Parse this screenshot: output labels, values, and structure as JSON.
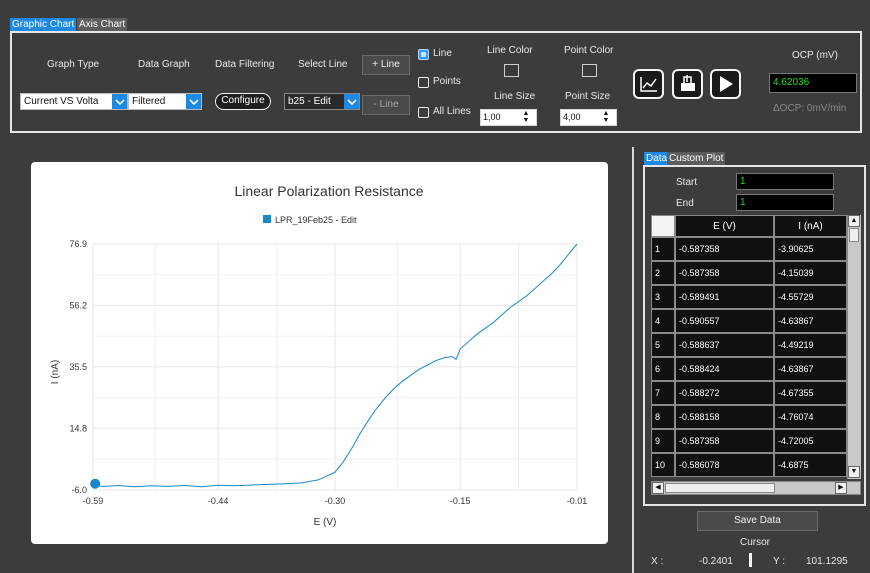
{
  "tabs": [
    {
      "label": "Graphic Chart",
      "active": true
    },
    {
      "label": "Axis Chart",
      "active": false
    }
  ],
  "toolbar": {
    "graph_type": {
      "label": "Graph Type",
      "value": "Current VS Volta"
    },
    "data_graph": {
      "label": "Data Graph",
      "value": "Filtered"
    },
    "data_filtering": {
      "label": "Data Filtering",
      "button": "Configure"
    },
    "select_line": {
      "label": "Select Line",
      "value": "b25 - Edit"
    },
    "add_line": "+ Line",
    "remove_line": "- Line",
    "mode": {
      "line": "Line",
      "points": "Points",
      "all_lines": "All Lines",
      "selected": "Line"
    },
    "line_color": {
      "label": "Line Color",
      "value": "#3a3a3a"
    },
    "point_color": {
      "label": "Point Color",
      "value": "#3a3a3a"
    },
    "line_size": {
      "label": "Line Size",
      "value": "1,00"
    },
    "point_size": {
      "label": "Point Size",
      "value": "4,00"
    },
    "icons": [
      "chart-icon",
      "export-icon",
      "play-icon"
    ],
    "ocp": {
      "label": "OCP (mV)",
      "value": "4.62036",
      "delta": "ΔOCP: 0mV/min"
    }
  },
  "chart_data": {
    "type": "line",
    "title": "Linear Polarization Resistance",
    "series": [
      {
        "name": "LPR_19Feb25 - Edit",
        "color": "#1a88c9"
      }
    ],
    "xlabel": "E (V)",
    "ylabel": "I (nA)",
    "xlim": [
      -0.59,
      -0.01
    ],
    "ylim": [
      -6.0,
      76.9
    ],
    "x_ticks": [
      "-0.59",
      "-0.44",
      "-0.30",
      "-0.15",
      "-0.01"
    ],
    "y_ticks": [
      "76.9",
      "56.2",
      "35.5",
      "14.8",
      "-6.0"
    ],
    "points": [
      [
        -0.5874,
        -3.9
      ],
      [
        -0.586,
        -4.7
      ],
      [
        -0.575,
        -4.8
      ],
      [
        -0.56,
        -4.5
      ],
      [
        -0.54,
        -4.9
      ],
      [
        -0.52,
        -4.6
      ],
      [
        -0.5,
        -4.8
      ],
      [
        -0.48,
        -4.5
      ],
      [
        -0.46,
        -4.9
      ],
      [
        -0.44,
        -4.4
      ],
      [
        -0.42,
        -4.6
      ],
      [
        -0.4,
        -4.3
      ],
      [
        -0.38,
        -4.1
      ],
      [
        -0.36,
        -3.9
      ],
      [
        -0.34,
        -3.6
      ],
      [
        -0.32,
        -2.6
      ],
      [
        -0.3,
        0.0
      ],
      [
        -0.29,
        3.5
      ],
      [
        -0.28,
        8.0
      ],
      [
        -0.27,
        13.0
      ],
      [
        -0.26,
        17.5
      ],
      [
        -0.25,
        21.5
      ],
      [
        -0.24,
        25.0
      ],
      [
        -0.23,
        28.0
      ],
      [
        -0.22,
        30.5
      ],
      [
        -0.21,
        32.5
      ],
      [
        -0.2,
        34.5
      ],
      [
        -0.19,
        36.0
      ],
      [
        -0.18,
        37.5
      ],
      [
        -0.17,
        38.5
      ],
      [
        -0.16,
        39.0
      ],
      [
        -0.155,
        38.0
      ],
      [
        -0.15,
        41.5
      ],
      [
        -0.14,
        44.0
      ],
      [
        -0.13,
        46.5
      ],
      [
        -0.12,
        48.5
      ],
      [
        -0.11,
        50.5
      ],
      [
        -0.1,
        53.0
      ],
      [
        -0.09,
        55.5
      ],
      [
        -0.08,
        57.5
      ],
      [
        -0.07,
        59.5
      ],
      [
        -0.06,
        62.0
      ],
      [
        -0.05,
        64.5
      ],
      [
        -0.04,
        67.0
      ],
      [
        -0.03,
        70.0
      ],
      [
        -0.02,
        73.5
      ],
      [
        -0.01,
        76.9
      ]
    ]
  },
  "data_panel": {
    "tabs": [
      {
        "label": "Data",
        "active": true
      },
      {
        "label": "Custom Plot",
        "active": false
      }
    ],
    "start": {
      "label": "Start",
      "value": "1"
    },
    "end": {
      "label": "End",
      "value": "1"
    },
    "columns": [
      "E (V)",
      "I (nA)"
    ],
    "rows": [
      {
        "n": "1",
        "e": "-0.587358",
        "i": "-3.90625"
      },
      {
        "n": "2",
        "e": "-0.587358",
        "i": "-4.15039"
      },
      {
        "n": "3",
        "e": "-0.589491",
        "i": "-4.55729"
      },
      {
        "n": "4",
        "e": "-0.590557",
        "i": "-4.63867"
      },
      {
        "n": "5",
        "e": "-0.588637",
        "i": "-4.49219"
      },
      {
        "n": "6",
        "e": "-0.588424",
        "i": "-4.63867"
      },
      {
        "n": "7",
        "e": "-0.588272",
        "i": "-4.67355"
      },
      {
        "n": "8",
        "e": "-0.588158",
        "i": "-4.76074"
      },
      {
        "n": "9",
        "e": "-0.587358",
        "i": "-4.72005"
      },
      {
        "n": "10",
        "e": "-0.586078",
        "i": "-4.6875"
      }
    ],
    "save_label": "Save Data",
    "cursor": {
      "label": "Cursor",
      "x_label": "X :",
      "x_value": "-0.2401",
      "y_label": "Y :",
      "y_value": "101.1295"
    }
  }
}
